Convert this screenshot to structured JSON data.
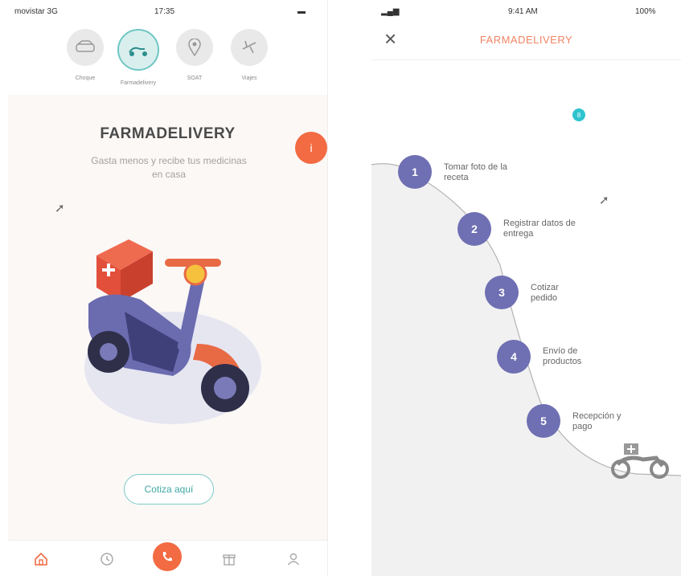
{
  "left": {
    "status": {
      "carrier": "movistar 3G",
      "time": "17:35"
    },
    "categories": [
      {
        "label": "Choque",
        "icon": "car-crash-icon"
      },
      {
        "label": "Farmadelivery",
        "icon": "scooter-icon"
      },
      {
        "label": "SOAT",
        "icon": "location-pin-icon"
      },
      {
        "label": "Viajes",
        "icon": "airplane-icon"
      }
    ],
    "title": "FARMADELIVERY",
    "subtitle": "Gasta menos y recibe tus medicinas en casa",
    "cta_label": "Cotiza aquí",
    "info_glyph": "i",
    "tabs": [
      "home-icon",
      "history-icon",
      "phone-icon",
      "gift-icon",
      "user-icon"
    ]
  },
  "right": {
    "status": {
      "time": "9:41 AM",
      "battery": "100%"
    },
    "title": "FARMADELIVERY",
    "close_glyph": "×",
    "badge": "8",
    "steps": [
      {
        "num": "1",
        "text": "Tomar foto de la receta"
      },
      {
        "num": "2",
        "text": "Registrar datos de entrega"
      },
      {
        "num": "3",
        "text": "Cotizar pedido"
      },
      {
        "num": "4",
        "text": "Envío de productos"
      },
      {
        "num": "5",
        "text": "Recepción y pago"
      }
    ]
  },
  "colors": {
    "accent": "#f26b43",
    "teal": "#6ec7c4",
    "step_purple": "#6f6fb3",
    "scooter_body": "#6b6bb0",
    "box_red": "#e2503b"
  }
}
